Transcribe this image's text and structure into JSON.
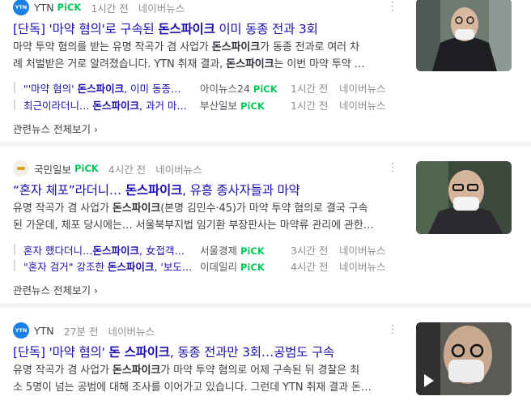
{
  "news": [
    {
      "press": "YTN",
      "pick": "PiCK",
      "time": "1시간 전",
      "site": "네이버뉴스",
      "title_pre": "[단독] '마약 혐의'로 구속된 ",
      "title_kw": "돈스파이크",
      "title_post": " 이미 동종 전과 3회",
      "desc_1a": "마약 투약 혐의를 받는 유명 작곡가 겸 사업가 ",
      "desc_1b": "돈스파이크",
      "desc_1c": "가 동종 전과로 여러 차",
      "desc_2a": "례 처벌받은 거로 알려졌습니다. YTN 취재 결과, ",
      "desc_2b": "돈스파이크",
      "desc_2c": "는 이번 마약 투약 …",
      "related": [
        {
          "pre": "\"'마약 혐의' ",
          "kw": "돈스파이크",
          "post": ", 이미 동종…",
          "press": "아이뉴스24",
          "pick": "PiCK",
          "time": "1시간 전",
          "site": "네이버뉴스"
        },
        {
          "pre": "최근이라더니… ",
          "kw": "돈스파이크",
          "post": ", 과거 마…",
          "press": "부산일보",
          "pick": "PiCK",
          "time": "1시간 전",
          "site": "네이버뉴스"
        }
      ],
      "more": "관련뉴스 전체보기"
    },
    {
      "press": "국민일보",
      "pick": "PiCK",
      "time": "4시간 전",
      "site": "네이버뉴스",
      "title_pre": "“혼자 체포”라더니… ",
      "title_kw": "돈스파이크",
      "title_post": ", 유흥 종사자들과 마약",
      "desc_1a": "유명 작곡가 겸 사업가 ",
      "desc_1b": "돈스파이크",
      "desc_1c": "(본명 김민수·45)가 마약 투약 혐의로 결국 구속",
      "desc_2a": "된 가운데, 체포 당시에는… 서울북부지법 임기환 부장판사는 마약류 관리에 관한…",
      "desc_2b": "",
      "desc_2c": "",
      "related": [
        {
          "pre": "혼자 했다더니…",
          "kw": "돈스파이크",
          "post": ", 女접객…",
          "press": "서울경제",
          "pick": "PiCK",
          "time": "3시간 전",
          "site": "네이버뉴스"
        },
        {
          "pre": "\"혼자 검거\" 강조한 ",
          "kw": "돈스파이크",
          "post": ", '보도…",
          "press": "이데일리",
          "pick": "PiCK",
          "time": "4시간 전",
          "site": "네이버뉴스"
        }
      ],
      "more": "관련뉴스 전체보기"
    },
    {
      "press": "YTN",
      "time": "27분 전",
      "site": "네이버뉴스",
      "title_pre": "[단독] '마약 혐의' ",
      "title_kw": "돈 스파이크",
      "title_post": ", 동종 전과만 3회…공범도 구속",
      "desc_1a": "유명 작곡가 겸 사업가 ",
      "desc_1b": "돈스파이크",
      "desc_1c": "가 마약 투약 혐의로 어제 구속된 뒤 경찰은 최",
      "desc_2a": "소 5명이 넘는 공범에 대해 조사를 이어가고 있습니다. 그런데 YTN 취재 결과 돈…",
      "desc_2b": "",
      "desc_2c": ""
    }
  ],
  "icons": {
    "menu": "more-vertical-icon",
    "play": "play-icon",
    "chevron": "chevron-right-icon"
  }
}
